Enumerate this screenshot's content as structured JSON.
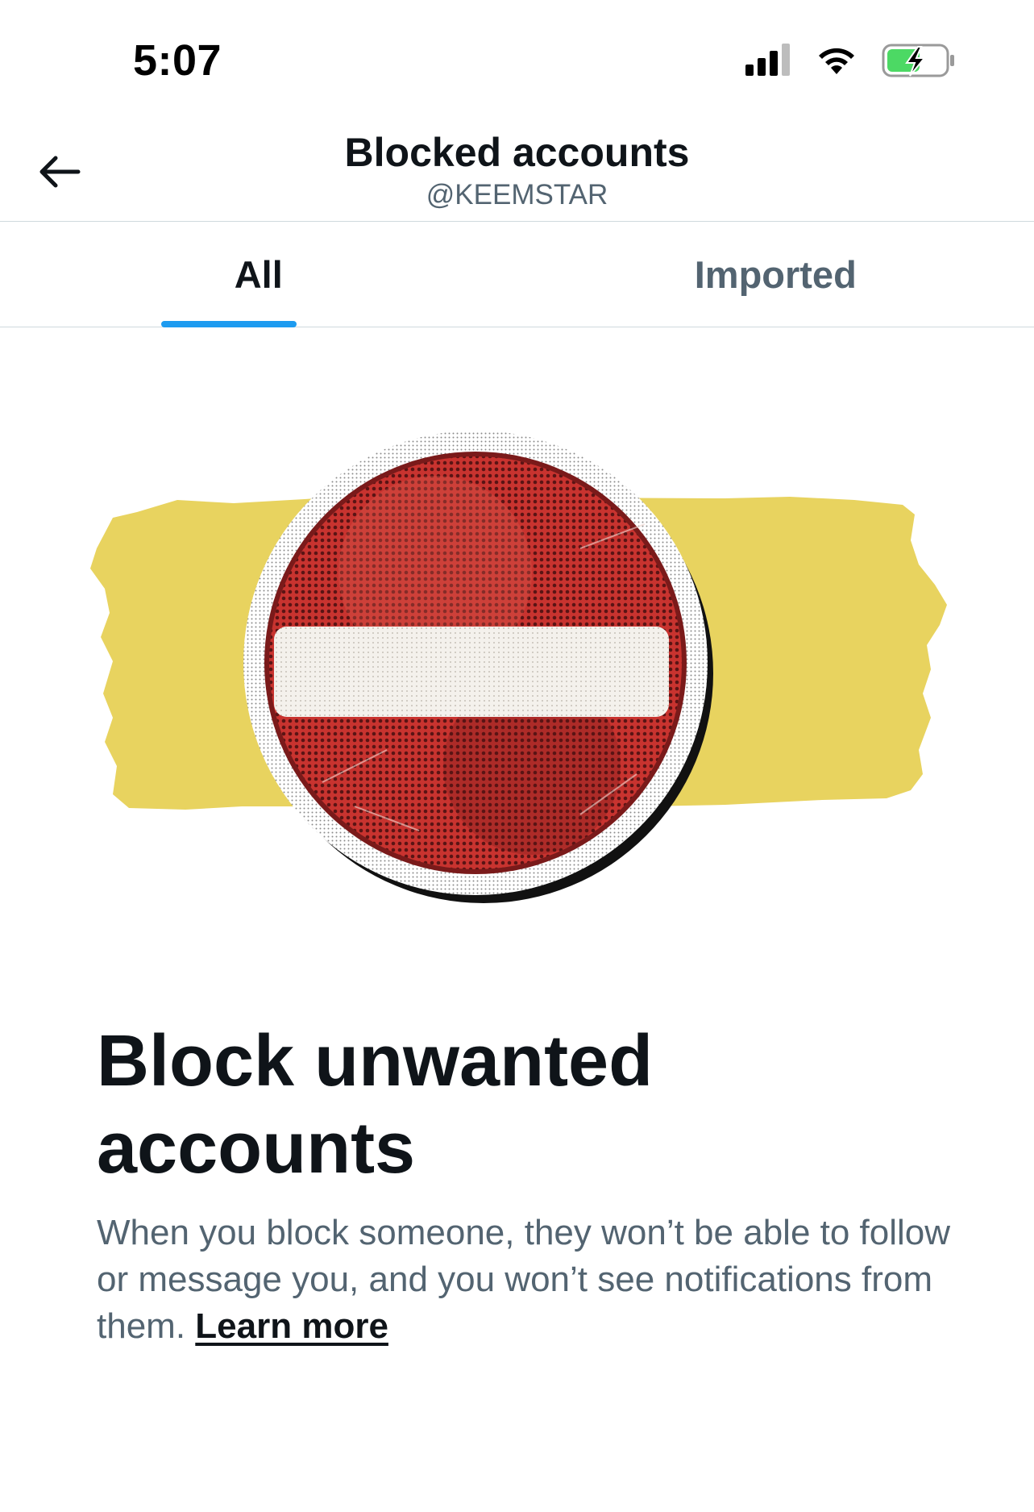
{
  "status_bar": {
    "time": "5:07",
    "icons": [
      "cellular-signal-icon",
      "wifi-icon",
      "battery-charging-icon"
    ]
  },
  "header": {
    "back_icon": "arrow-left-icon",
    "title": "Blocked accounts",
    "subtitle": "@KEEMSTAR"
  },
  "tabs": [
    {
      "label": "All",
      "active": true
    },
    {
      "label": "Imported",
      "active": false
    }
  ],
  "illustration": {
    "icon": "no-entry-sign-icon",
    "colors": {
      "band": "#e8d35f",
      "sign_red": "#c8332f",
      "sign_dark": "#8e1f1f",
      "bar": "#f4f1ec"
    }
  },
  "empty_state": {
    "title": "Block unwanted accounts",
    "description": "When you block someone, they won’t be able to follow or message you, and you won’t see notifications from them.",
    "link_label": "Learn more"
  },
  "colors": {
    "accent": "#1d9bf0",
    "primary_text": "#0f1419",
    "secondary_text": "#536471",
    "divider": "#cfd9de"
  }
}
